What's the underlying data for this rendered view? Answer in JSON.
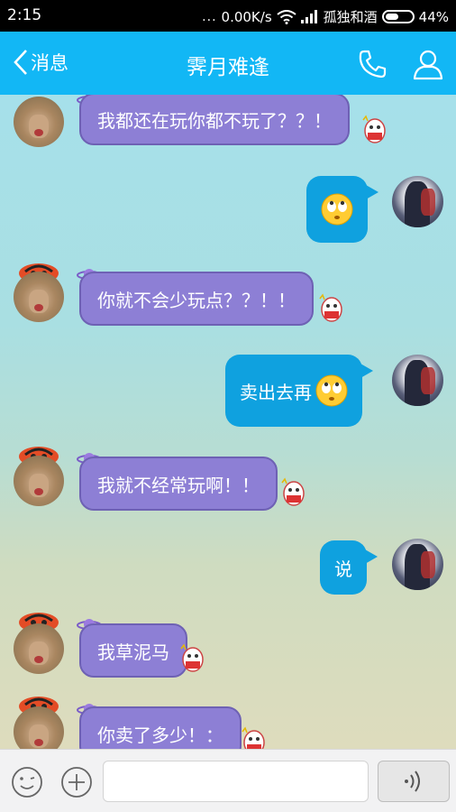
{
  "status_bar": {
    "time": "2:15",
    "signal_dots": "...",
    "network_speed": "0.00K/s",
    "carrier": "孤独和酒",
    "battery": "44%"
  },
  "header": {
    "back_label": "消息",
    "title": "霁月难逢",
    "accent_color": "#12b7f5"
  },
  "messages": [
    {
      "side": "left",
      "text": "我都还在玩你都不玩了？？！"
    },
    {
      "side": "right",
      "text": "",
      "emoji": "rolling-eyes-emoji"
    },
    {
      "side": "left",
      "text": "你就不会少玩点？？！！"
    },
    {
      "side": "right",
      "text": "卖出去再",
      "emoji": "rolling-eyes-emoji"
    },
    {
      "side": "left",
      "text": "我就不经常玩啊！！"
    },
    {
      "side": "right",
      "text": "说"
    },
    {
      "side": "left",
      "text": "我草泥马"
    },
    {
      "side": "left",
      "text": "你卖了多少！："
    }
  ],
  "input_bar": {
    "value": "",
    "emoji_icon": "smiley-icon",
    "plus_icon": "plus-circle-icon",
    "voice_icon": "voice-wave-icon"
  }
}
